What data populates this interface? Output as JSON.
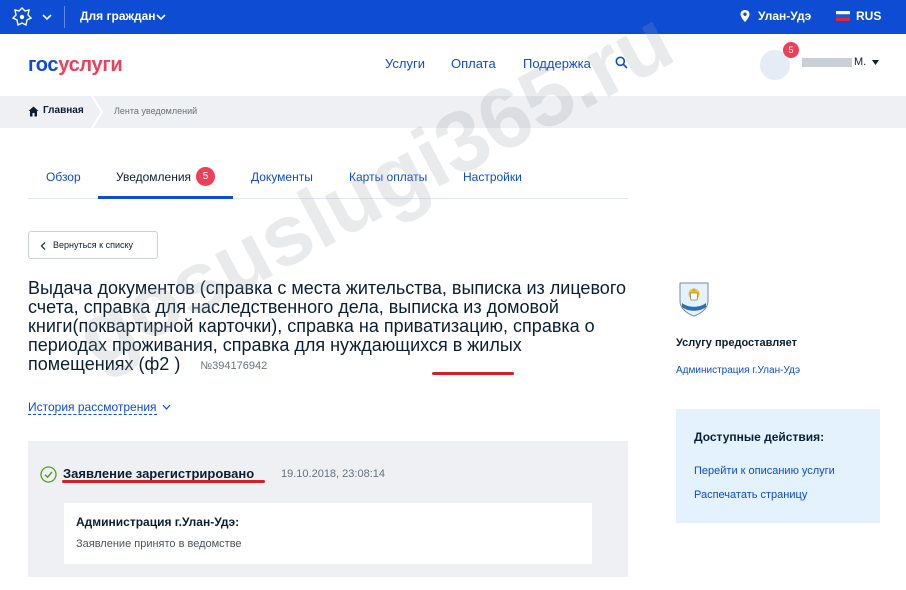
{
  "topbar": {
    "for_citizens": "Для граждан",
    "city": "Улан-Удэ",
    "lang": "RUS"
  },
  "header": {
    "logo_part1": "гос",
    "logo_part2": "услуги",
    "nav": [
      "Услуги",
      "Оплата",
      "Поддержка"
    ],
    "notif_count": "5",
    "user_name": "М."
  },
  "breadcrumbs": {
    "home": "Главная",
    "current": "Лента уведомлений"
  },
  "tabs": {
    "items": [
      "Обзор",
      "Уведомления",
      "Документы",
      "Карты оплаты",
      "Настройки"
    ],
    "active": "Уведомления",
    "badge": "5"
  },
  "back_button": "Вернуться к списку",
  "application": {
    "title": "Выдача документов (справка с места жительства, выписка из лицевого счета, справка для наследственного дела, выписка из домовой книги(поквартирной карточки), справка на приватизацию, справка о периодах проживания, справка для нуждающихся в жилых помещениях (ф2 )",
    "number": "№394176942",
    "history_label": "История рассмотрения"
  },
  "status": {
    "title": "Заявление зарегистрировано",
    "datetime": "19.10.2018, 23:08:14",
    "org": "Администрация г.Улан-Удэ:",
    "message": "Заявление принято в ведомстве"
  },
  "sidebar": {
    "provider_label": "Услугу предоставляет",
    "provider_name": "Администрация г.Улан-Удэ",
    "actions_title": "Доступные действия:",
    "actions": [
      "Перейти к описанию услуги",
      "Распечатать страницу"
    ]
  },
  "watermark": "gosuslugi365.ru",
  "colors": {
    "brand_blue": "#0d4cd3",
    "brand_red": "#ee3f58",
    "annotation_red": "#d61f26"
  }
}
